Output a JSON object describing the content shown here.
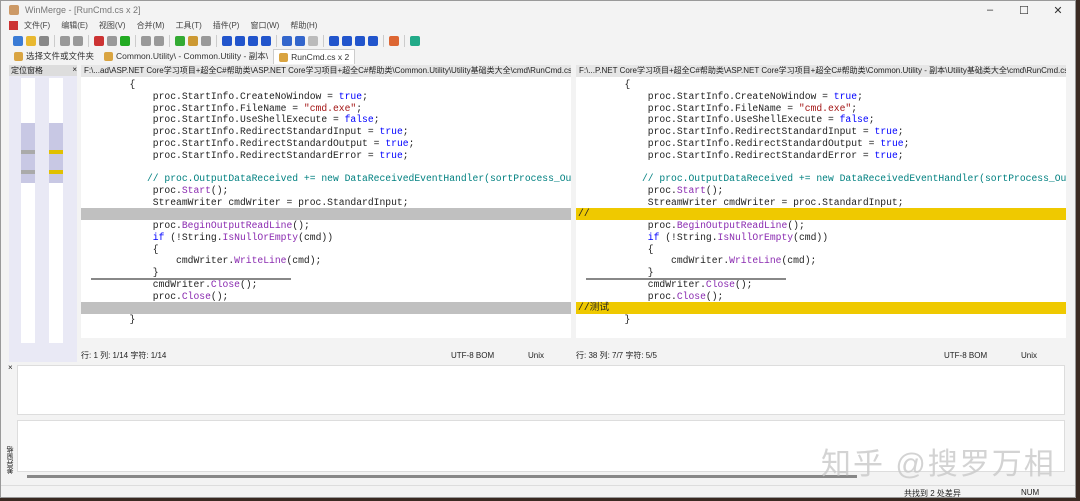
{
  "window": {
    "title": "WinMerge - [RunCmd.cs x 2]"
  },
  "menu": [
    "文件(F)",
    "编辑(E)",
    "视图(V)",
    "合并(M)",
    "工具(T)",
    "插件(P)",
    "窗口(W)",
    "帮助(H)"
  ],
  "tabs": [
    {
      "label": "选择文件或文件夹"
    },
    {
      "label": "Common.Utility\\ - Common.Utility - 副本\\"
    },
    {
      "label": "RunCmd.cs x 2"
    }
  ],
  "location_pane": {
    "title": "定位窗格",
    "close": "×"
  },
  "left": {
    "path": "F:\\...ad\\ASP.NET Core学习项目+超全C#帮助类\\ASP.NET Core学习项目+超全C#帮助类\\Common.Utility\\Utility基础类大全\\cmd\\RunCmd.cs",
    "marker": "▪",
    "status": {
      "pos": "行: 1  列: 1/14  字符: 1/14",
      "enc": "UTF-8 BOM",
      "eol": "Unix"
    }
  },
  "right": {
    "path": "F:\\...P.NET Core学习项目+超全C#帮助类\\ASP.NET Core学习项目+超全C#帮助类\\Common.Utility - 副本\\Utility基础类大全\\cmd\\RunCmd.cs",
    "marker": "▪",
    "status": {
      "pos": "行: 38  列: 7/7  字符: 5/5",
      "enc": "UTF-8 BOM",
      "eol": "Unix"
    }
  },
  "code": [
    [
      [
        "        {",
        ""
      ]
    ],
    [
      [
        "            proc.StartInfo.CreateNoWindow = ",
        ""
      ],
      [
        "true",
        "kw"
      ],
      [
        ";",
        ""
      ]
    ],
    [
      [
        "            proc.StartInfo.FileName = ",
        ""
      ],
      [
        "\"cmd.exe\"",
        "str"
      ],
      [
        ";",
        ""
      ]
    ],
    [
      [
        "            proc.StartInfo.UseShellExecute = ",
        ""
      ],
      [
        "false",
        "kw"
      ],
      [
        ";",
        ""
      ]
    ],
    [
      [
        "            proc.StartInfo.RedirectStandardInput = ",
        ""
      ],
      [
        "true",
        "kw"
      ],
      [
        ";",
        ""
      ]
    ],
    [
      [
        "            proc.StartInfo.RedirectStandardOutput = ",
        ""
      ],
      [
        "true",
        "kw"
      ],
      [
        ";",
        ""
      ]
    ],
    [
      [
        "            proc.StartInfo.RedirectStandardError = ",
        ""
      ],
      [
        "true",
        "kw"
      ],
      [
        ";",
        ""
      ]
    ],
    [],
    [
      [
        "           // proc.OutputDataReceived += new DataReceivedEventHandler(sortProcess_OutputDataReceived);",
        "cm"
      ]
    ],
    [
      [
        "            proc.",
        ""
      ],
      [
        "Start",
        "mt"
      ],
      [
        "();",
        ""
      ]
    ],
    [
      [
        "            StreamWriter cmdWriter = proc.StandardInput;",
        ""
      ]
    ],
    "DIFF1",
    [
      [
        "            proc.",
        ""
      ],
      [
        "BeginOutputReadLine",
        "mt"
      ],
      [
        "();",
        ""
      ]
    ],
    [
      [
        "            ",
        ""
      ],
      [
        "if",
        "kw"
      ],
      [
        " (!String.",
        ""
      ],
      [
        "IsNullOrEmpty",
        "mt"
      ],
      [
        "(cmd))",
        ""
      ]
    ],
    [
      [
        "            {",
        ""
      ]
    ],
    [
      [
        "                cmdWriter.",
        ""
      ],
      [
        "WriteLine",
        "mt"
      ],
      [
        "(cmd);",
        ""
      ]
    ],
    [
      [
        "            }",
        ""
      ]
    ],
    [
      [
        "            cmdWriter.",
        ""
      ],
      [
        "Close",
        "mt"
      ],
      [
        "();",
        ""
      ]
    ],
    [
      [
        "            proc.",
        ""
      ],
      [
        "Close",
        "mt"
      ],
      [
        "();",
        ""
      ]
    ],
    "DIFF2",
    [
      [
        "        }",
        ""
      ]
    ]
  ],
  "diffs": {
    "DIFF1": {
      "left": "",
      "right": "//"
    },
    "DIFF2": {
      "left": "",
      "right": "//测试"
    }
  },
  "statusbar": {
    "diff_count": "共找到 2 处差异",
    "num": "NUM"
  },
  "diff_pane": {
    "title": "差异窗格"
  },
  "watermark": "知乎 @搜罗万相",
  "colors": {
    "diff_yellow": "#efc900",
    "diff_gray": "#c0c0c0"
  }
}
